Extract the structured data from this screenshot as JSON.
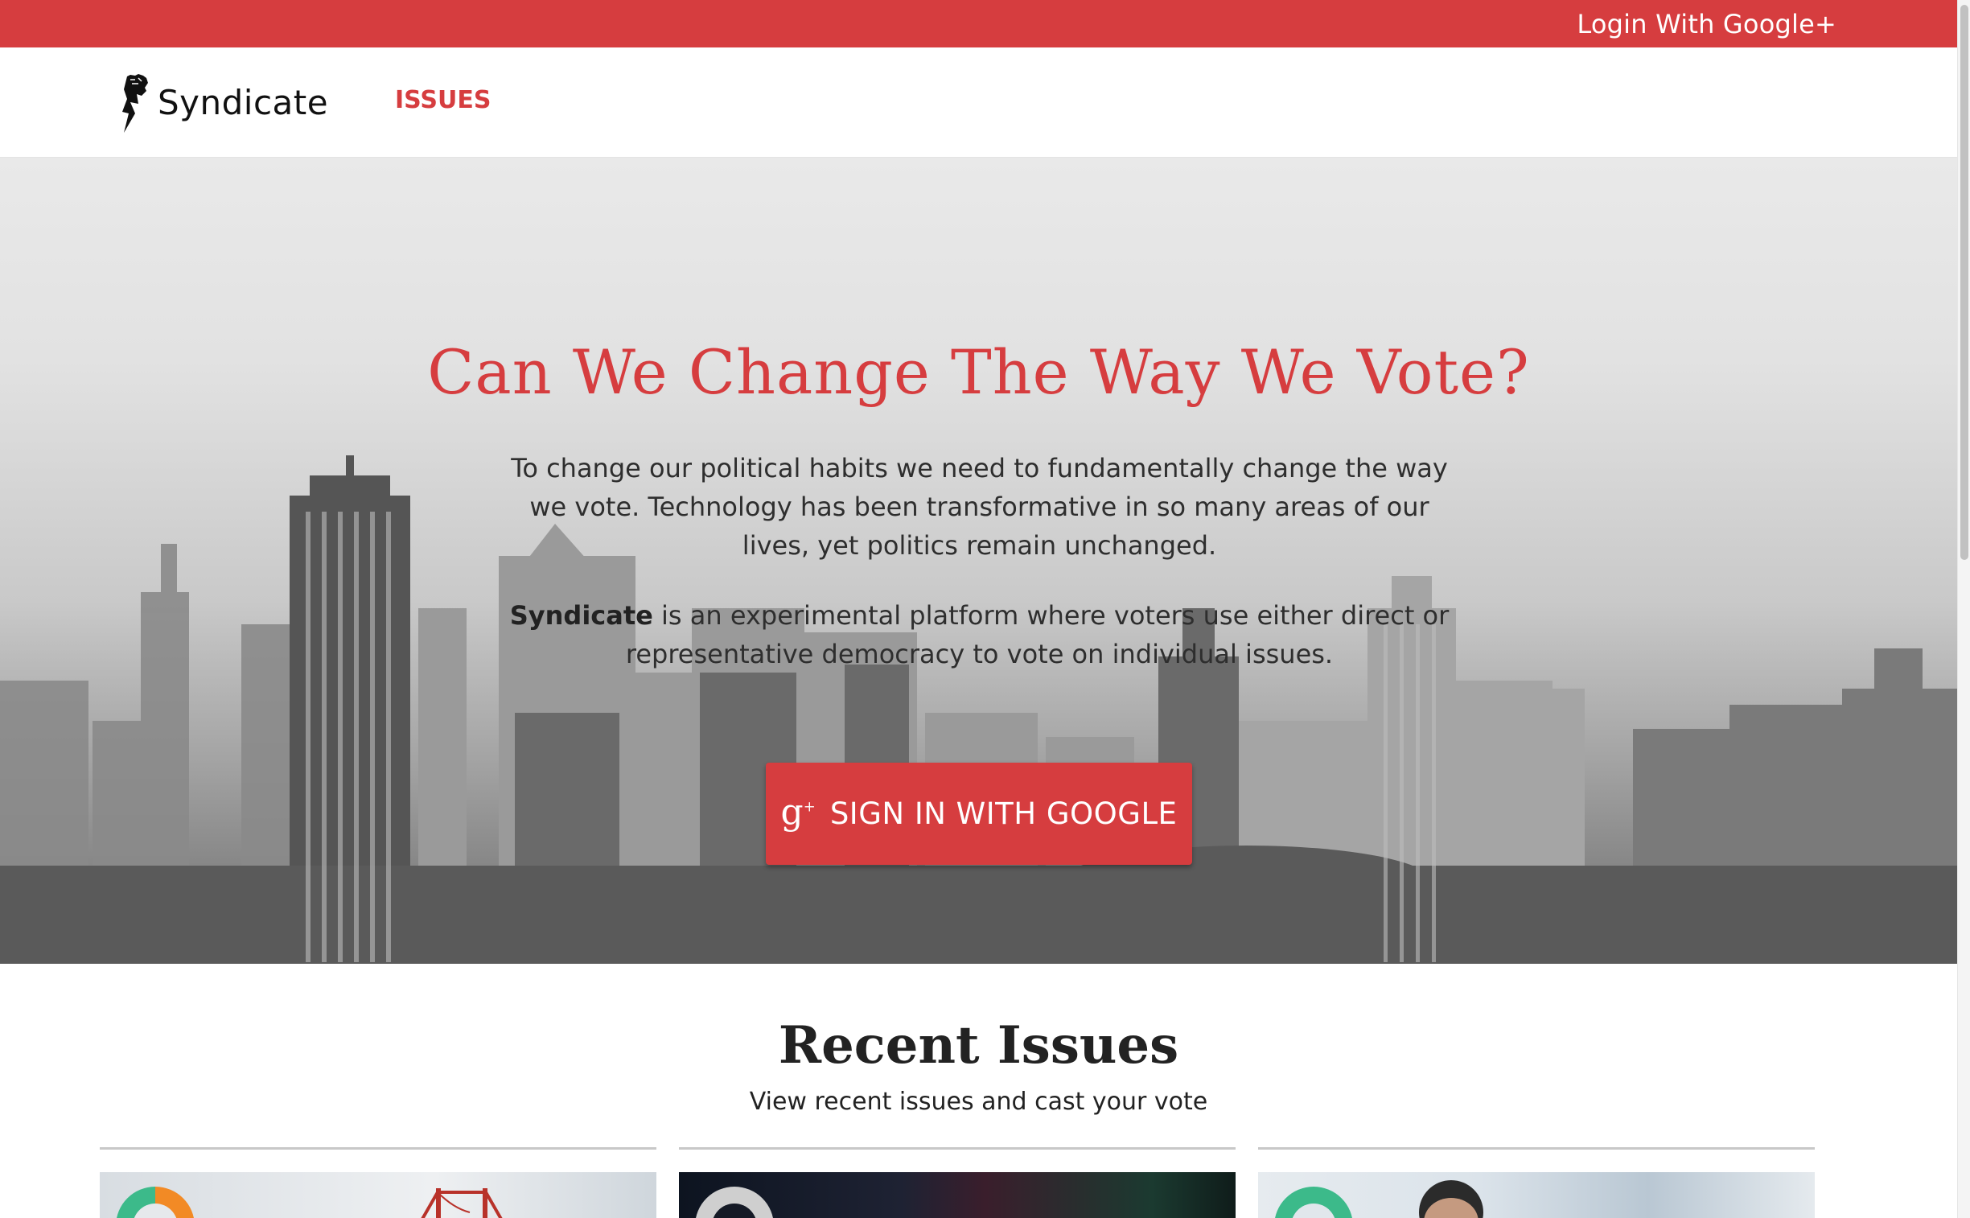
{
  "topbar": {
    "login_label": "Login With Google+"
  },
  "navbar": {
    "brand": "Syndicate",
    "issues_label": "ISSUES"
  },
  "hero": {
    "title": "Can We Change The Way We Vote?",
    "paragraph1": "To change our political habits we need to fundamentally change the way we vote. Technology has been transformative in so many areas of our lives, yet politics remain unchanged.",
    "paragraph2_bold": "Syndicate",
    "paragraph2_rest": " is an experimental platform where voters use either direct or representative democracy to vote on individual issues.",
    "signin_icon": "g+",
    "signin_label": "SIGN IN WITH GOOGLE",
    "background": "grayscale city skyline"
  },
  "recent": {
    "title": "Recent Issues",
    "subtitle": "View recent issues and cast your vote",
    "cards": [
      {
        "donut_colors": [
          "#3cba8a",
          "#f28a25"
        ]
      },
      {
        "donut_colors": [
          "#cfcfcf",
          "#cfcfcf"
        ]
      },
      {
        "donut_colors": [
          "#3cba8a",
          "#3cba8a"
        ]
      }
    ]
  },
  "colors": {
    "accent": "#d63d3f",
    "text": "#333333"
  }
}
